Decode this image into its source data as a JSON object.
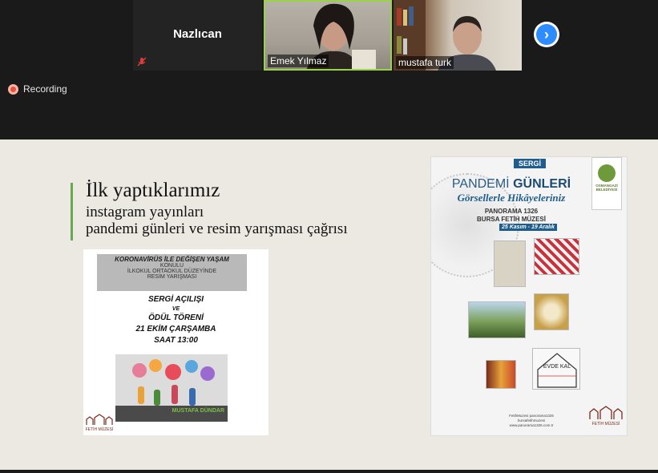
{
  "participants": [
    {
      "name": "Nazlıcan",
      "muted": true
    },
    {
      "name": "Emek Yılmaz",
      "speaking": true
    },
    {
      "name": "mustafa turk"
    }
  ],
  "recording": {
    "label": "Recording"
  },
  "slide": {
    "title": "İlk yaptıklarımız",
    "line2": "instagram yayınları",
    "line3": "pandemi günleri ve resim yarışması çağrısı",
    "poster1": {
      "head1": "KORONAVİRÜS İLE DEĞİŞEN YAŞAM",
      "head2": "KONULU",
      "head3": "İLKOKUL ORTAOKUL DÜZEYİNDE",
      "head4": "RESİM YARIŞMASI",
      "body1": "SERGİ AÇILIŞI",
      "body2": "VE",
      "body3": "ÖDÜL TÖRENİ",
      "body4": "21 EKİM ÇARŞAMBA",
      "body5": "SAAT 13:00",
      "sponsor": "MUSTAFA DÜNDAR",
      "logo": "FETİH MÜZESİ"
    },
    "poster2": {
      "tag": "SERGİ",
      "title_a": "PANDEMİ",
      "title_b": "GÜNLERİ",
      "subtitle": "Görsellerle Hikâyeleriniz",
      "panorama": "PANORAMA 1326",
      "museum": "BURSA FETİH MÜZESİ",
      "dates": "25 Kasım - 19 Aralık",
      "ribbon": "OSMANGAZİ BELEDİYESİ",
      "photo_text": "EVDE KAL",
      "footer1": "FetihMuzesi   panorama1326",
      "footer2": "bursafetihmuzesi",
      "footer3": "www.panorama1326.com.tr",
      "logo": "FETİH MÜZESİ"
    }
  },
  "colors": {
    "speaking_border": "#9ad24a",
    "accent": "#2d8cff",
    "recording": "#e8513a"
  }
}
